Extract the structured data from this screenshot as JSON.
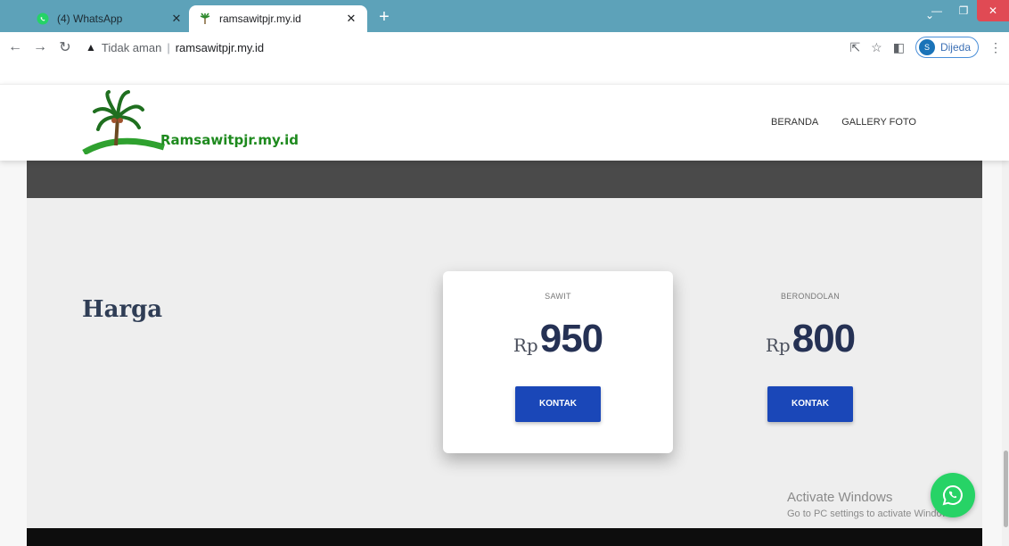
{
  "browser": {
    "tabs": [
      {
        "title": "(4) WhatsApp",
        "icon": "whatsapp-icon",
        "active": false
      },
      {
        "title": "ramsawitpjr.my.id",
        "icon": "palm-tree-icon",
        "active": true
      }
    ],
    "address": {
      "security_label": "Tidak aman",
      "url": "ramsawitpjr.my.id"
    },
    "profile_initial": "S",
    "profile_name": "Dijeda"
  },
  "site": {
    "logo_text": "Ramsawitpjr.my.id",
    "nav": [
      "BERANDA",
      "GALLERY FOTO"
    ]
  },
  "pricing": {
    "heading": "Harga",
    "cards": [
      {
        "label": "SAWIT",
        "currency": "Rp",
        "value": "950",
        "button": "KONTAK",
        "featured": true
      },
      {
        "label": "BERONDOLAN",
        "currency": "Rp",
        "value": "800",
        "button": "KONTAK",
        "featured": false
      }
    ]
  },
  "watermark": {
    "line1": "Activate Windows",
    "line2": "Go to PC settings to activate Windows."
  },
  "colors": {
    "tabbar": "#5da2b9",
    "accent_button": "#1a47b8",
    "price_text": "#253154",
    "whatsapp_green": "#27d366"
  }
}
